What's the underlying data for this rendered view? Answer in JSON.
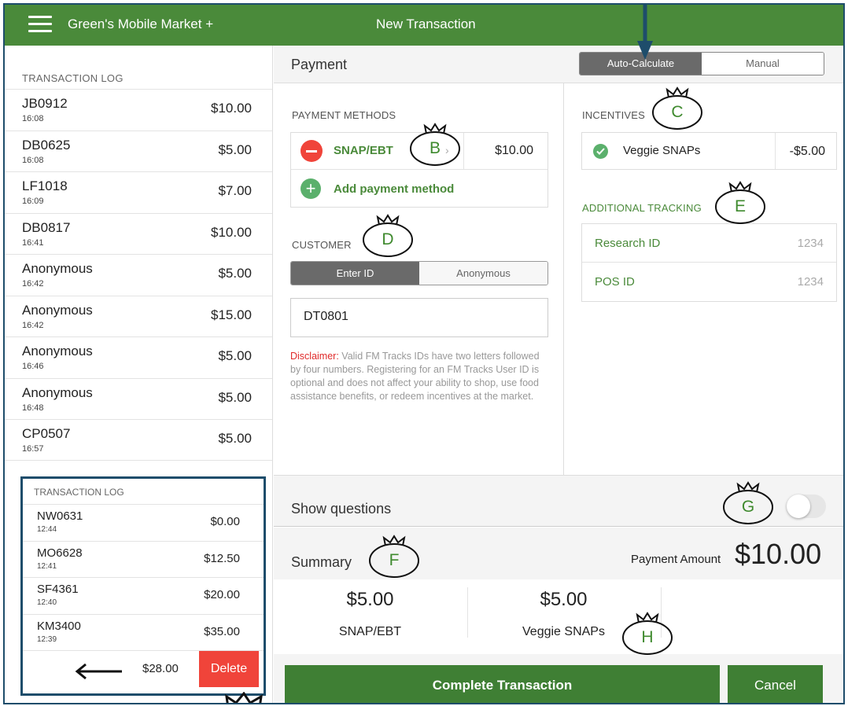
{
  "topbar": {
    "app_title": "Green's Mobile Market +",
    "screen_title": "New Transaction"
  },
  "log": {
    "header": "TRANSACTION LOG",
    "rows": [
      {
        "id": "JB0912",
        "time": "16:08",
        "amount": "$10.00"
      },
      {
        "id": "DB0625",
        "time": "16:08",
        "amount": "$5.00"
      },
      {
        "id": "LF1018",
        "time": "16:09",
        "amount": "$7.00"
      },
      {
        "id": "DB0817",
        "time": "16:41",
        "amount": "$10.00"
      },
      {
        "id": "Anonymous",
        "time": "16:42",
        "amount": "$5.00"
      },
      {
        "id": "Anonymous",
        "time": "16:42",
        "amount": "$15.00"
      },
      {
        "id": "Anonymous",
        "time": "16:46",
        "amount": "$5.00"
      },
      {
        "id": "Anonymous",
        "time": "16:48",
        "amount": "$5.00"
      },
      {
        "id": "CP0507",
        "time": "16:57",
        "amount": "$5.00"
      }
    ]
  },
  "inset": {
    "header": "TRANSACTION LOG",
    "rows": [
      {
        "id": "NW0631",
        "time": "12:44",
        "amount": "$0.00"
      },
      {
        "id": "MO6628",
        "time": "12:41",
        "amount": "$12.50"
      },
      {
        "id": "SF4361",
        "time": "12:40",
        "amount": "$20.00"
      },
      {
        "id": "KM3400",
        "time": "12:39",
        "amount": "$35.00"
      }
    ],
    "swipe_amount": "$28.00",
    "delete_label": "Delete"
  },
  "payment": {
    "title": "Payment",
    "mode_auto": "Auto-Calculate",
    "mode_manual": "Manual",
    "methods_label": "PAYMENT METHODS",
    "method_name": "SNAP/EBT",
    "method_amount": "$10.00",
    "add_method": "Add payment method"
  },
  "customer": {
    "label": "CUSTOMER",
    "tab_enter": "Enter ID",
    "tab_anon": "Anonymous",
    "id_value": "DT0801",
    "disclaimer_label": "Disclaimer:",
    "disclaimer_text": " Valid FM Tracks IDs have two letters followed by four numbers. Registering for an FM Tracks User ID is optional and does not affect your ability to shop, use food assistance benefits, or redeem incentives at the market."
  },
  "incentives": {
    "label": "INCENTIVES",
    "name": "Veggie SNAPs",
    "amount": "-$5.00"
  },
  "tracking": {
    "label": "ADDITIONAL TRACKING",
    "rows": [
      {
        "label": "Research ID",
        "value": "1234"
      },
      {
        "label": "POS ID",
        "value": "1234"
      }
    ]
  },
  "questions": {
    "label": "Show questions"
  },
  "summary": {
    "title": "Summary",
    "payment_amount_label": "Payment Amount",
    "payment_amount": "$10.00",
    "cells": [
      {
        "value": "$5.00",
        "name": "SNAP/EBT"
      },
      {
        "value": "$5.00",
        "name": "Veggie SNAPs"
      }
    ]
  },
  "actions": {
    "complete": "Complete Transaction",
    "cancel": "Cancel"
  },
  "markers": {
    "B": "B",
    "C": "C",
    "D": "D",
    "E": "E",
    "F": "F",
    "G": "G",
    "H": "H"
  },
  "colors": {
    "brand_green": "#4a8a3a",
    "delete_red": "#f0443a",
    "frame_blue": "#1e4d6b"
  }
}
